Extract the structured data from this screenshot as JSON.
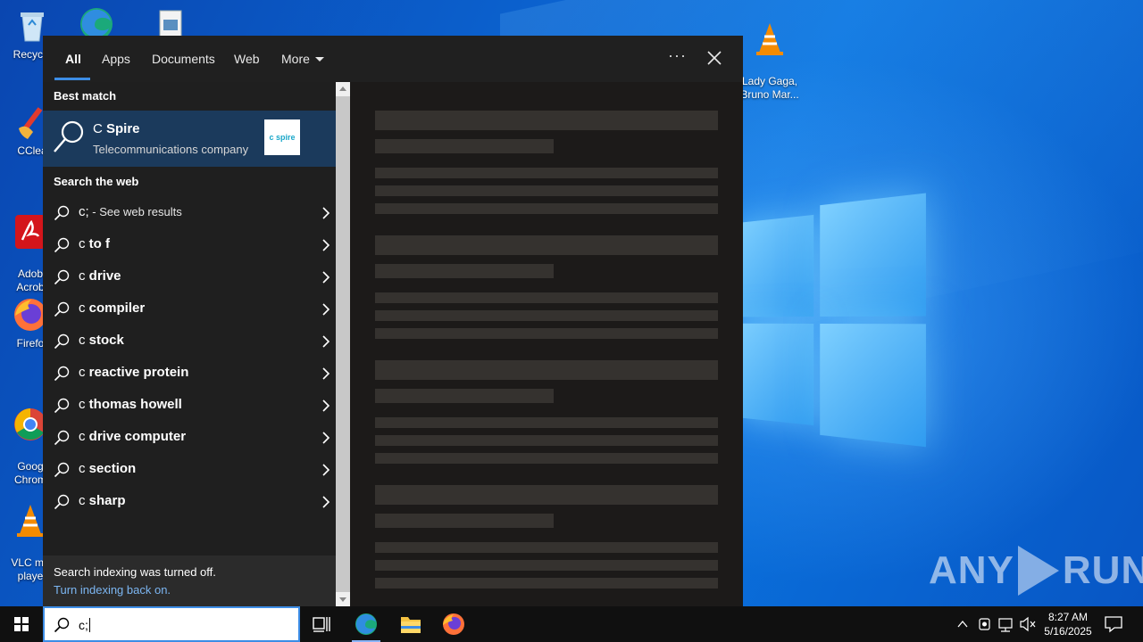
{
  "desktop": {
    "icons": [
      {
        "name": "recycle-bin",
        "label": "Recycle"
      },
      {
        "name": "ccleaner",
        "label": "CClea"
      },
      {
        "name": "adobe-acrobat",
        "label": "Adob\nAcrob"
      },
      {
        "name": "firefox",
        "label": "Firefo"
      },
      {
        "name": "google-chrome",
        "label": "Goog\nChrom"
      },
      {
        "name": "vlc-media-player",
        "label": "VLC me\nplaye"
      },
      {
        "name": "lady-gaga-vlc",
        "label": "Lady Gaga,\nBruno Mar..."
      }
    ],
    "watermark": {
      "left": "ANY",
      "right": "RUN"
    }
  },
  "search_panel": {
    "tabs": [
      {
        "label": "All",
        "active": true
      },
      {
        "label": "Apps"
      },
      {
        "label": "Documents"
      },
      {
        "label": "Web"
      },
      {
        "label": "More"
      }
    ],
    "more_options_label": "···",
    "best_match": {
      "section_label": "Best match",
      "title_query": "C",
      "title_rest": " Spire",
      "subtitle": "Telecommunications company",
      "logo_text": "c spire"
    },
    "web": {
      "section_label": "Search the web",
      "items": [
        {
          "query": "c;",
          "suffix": "",
          "note": " - See web results"
        },
        {
          "query": "c",
          "suffix": " to f",
          "note": ""
        },
        {
          "query": "c",
          "suffix": " drive",
          "note": ""
        },
        {
          "query": "c",
          "suffix": " compiler",
          "note": ""
        },
        {
          "query": "c",
          "suffix": " stock",
          "note": ""
        },
        {
          "query": "c",
          "suffix": " reactive protein",
          "note": ""
        },
        {
          "query": "c",
          "suffix": " thomas howell",
          "note": ""
        },
        {
          "query": "c",
          "suffix": " drive computer",
          "note": ""
        },
        {
          "query": "c",
          "suffix": " section",
          "note": ""
        },
        {
          "query": "c",
          "suffix": " sharp",
          "note": ""
        }
      ]
    },
    "indexing": {
      "message": "Search indexing was turned off.",
      "link": "Turn indexing back on."
    }
  },
  "taskbar": {
    "search_value": "c;",
    "clock_time": "8:27 AM",
    "clock_date": "5/16/2025"
  },
  "colors": {
    "accent": "#3c8de6",
    "best_match_bg": "#1b3a5c",
    "panel_bg": "#202020",
    "link": "#7cb6f2"
  }
}
